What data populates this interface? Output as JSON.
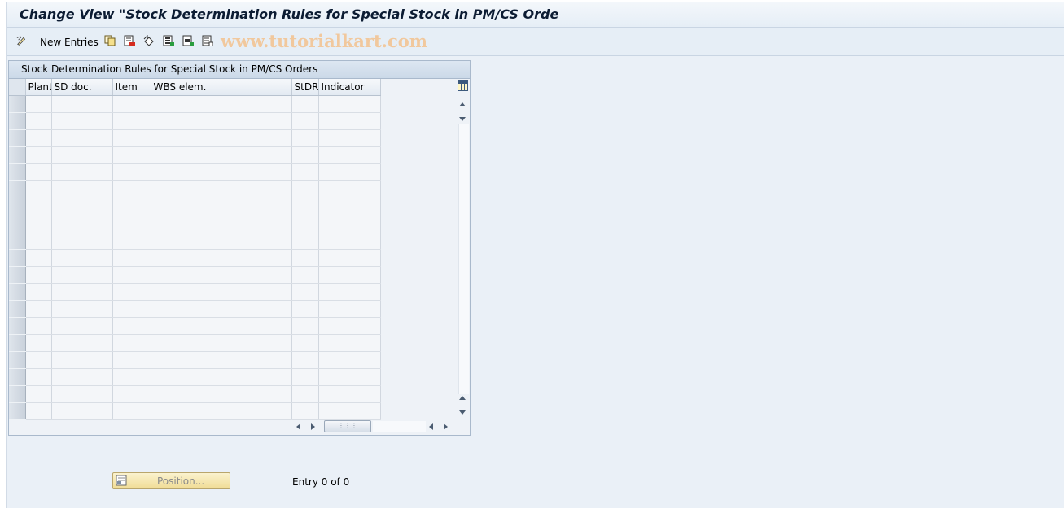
{
  "window": {
    "title": "Change View \"Stock Determination Rules for Special Stock in PM/CS Orde"
  },
  "toolbar": {
    "new_entries_label": "New Entries",
    "watermark": "www.tutorialkart.com"
  },
  "table": {
    "title": "Stock Determination Rules for Special Stock in PM/CS Orders",
    "columns": [
      "Plant",
      "SD doc.",
      "Item",
      "WBS elem.",
      "StDR",
      "Indicator"
    ],
    "row_count": 19
  },
  "footer": {
    "position_label": "Position...",
    "entry_info": "Entry 0 of 0"
  },
  "colors": {
    "background": "#eaf0f7",
    "title_text": "#0c1c33",
    "watermark": "#f1c89d",
    "position_button": "#f0dc95"
  }
}
